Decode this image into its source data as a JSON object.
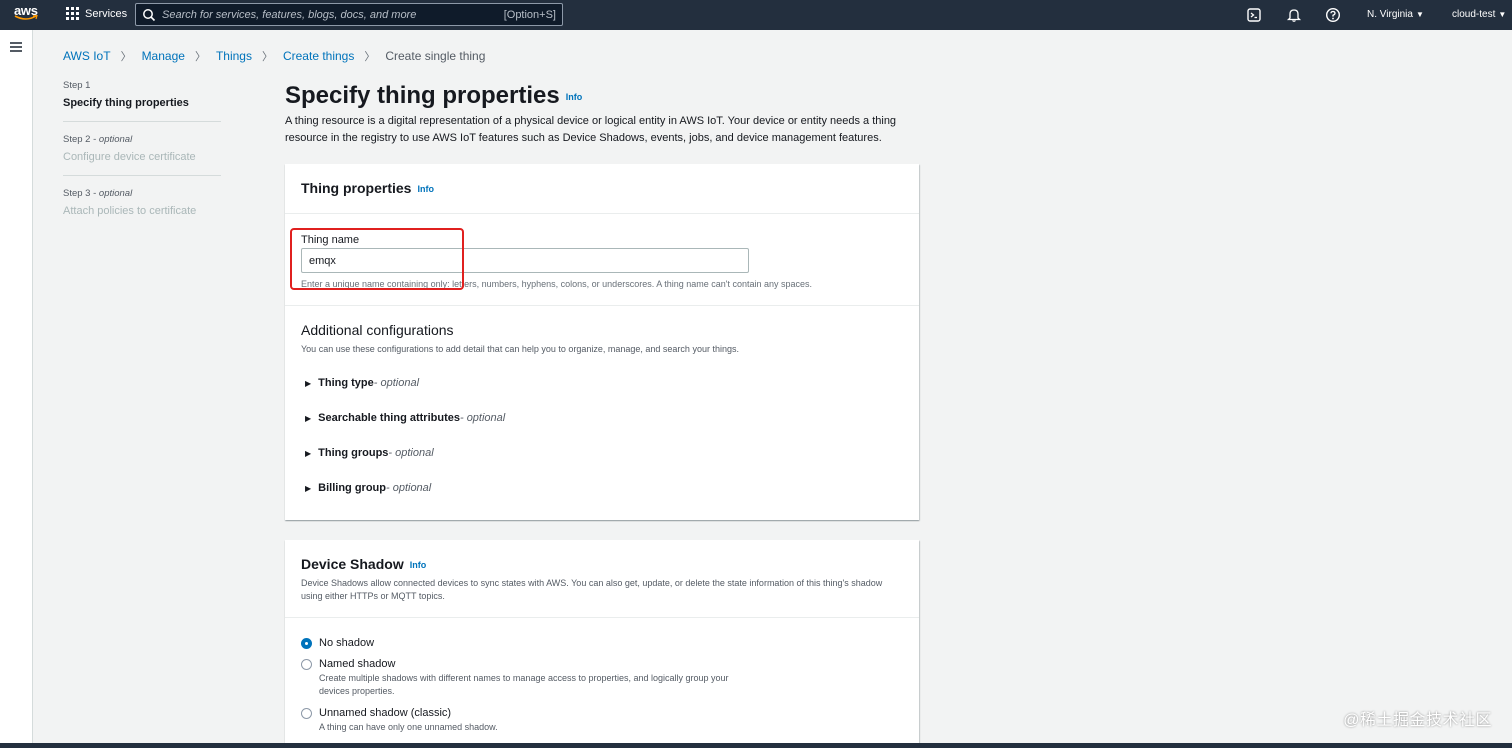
{
  "topnav": {
    "logo_text": "aws",
    "services_label": "Services",
    "search_placeholder": "Search for services, features, blogs, docs, and more",
    "search_shortcut": "[Option+S]",
    "region": "N. Virginia",
    "account": "cloud-test",
    "icons": [
      "cloudshell-icon",
      "bell-icon",
      "help-icon"
    ]
  },
  "breadcrumb": {
    "items": [
      "AWS IoT",
      "Manage",
      "Things",
      "Create things"
    ],
    "current": "Create single thing"
  },
  "steps": [
    {
      "label": "Step 1",
      "optional": "",
      "title": "Specify thing properties",
      "state": "active"
    },
    {
      "label": "Step 2 - ",
      "optional": "optional",
      "title": "Configure device certificate",
      "state": "disabled"
    },
    {
      "label": "Step 3 - ",
      "optional": "optional",
      "title": "Attach policies to certificate",
      "state": "disabled"
    }
  ],
  "page": {
    "title": "Specify thing properties",
    "info": "Info",
    "description": "A thing resource is a digital representation of a physical device or logical entity in AWS IoT. Your device or entity needs a thing resource in the registry to use AWS IoT features such as Device Shadows, events, jobs, and device management features."
  },
  "thing_properties": {
    "title": "Thing properties",
    "info": "Info",
    "name_label": "Thing name",
    "name_value": "emqx",
    "name_hint": "Enter a unique name containing only: letters, numbers, hyphens, colons, or underscores. A thing name can't contain any spaces.",
    "additional_title": "Additional configurations",
    "additional_desc": "You can use these configurations to add detail that can help you to organize, manage, and search your things.",
    "expanders": [
      {
        "label": "Thing type",
        "optional": " - optional"
      },
      {
        "label": "Searchable thing attributes",
        "optional": " - optional"
      },
      {
        "label": "Thing groups",
        "optional": " - optional"
      },
      {
        "label": "Billing group",
        "optional": " - optional"
      }
    ]
  },
  "device_shadow": {
    "title": "Device Shadow",
    "info": "Info",
    "description": "Device Shadows allow connected devices to sync states with AWS. You can also get, update, or delete the state information of this thing's shadow using either HTTPs or MQTT topics.",
    "options": [
      {
        "label": "No shadow",
        "desc": "",
        "checked": true
      },
      {
        "label": "Named shadow",
        "desc": "Create multiple shadows with different names to manage access to properties, and logically group your devices properties.",
        "checked": false
      },
      {
        "label": "Unnamed shadow (classic)",
        "desc": "A thing can have only one unnamed shadow.",
        "checked": false
      }
    ]
  },
  "watermark": "@稀土掘金技术社区",
  "colors": {
    "nav_bg": "#232f3e",
    "link": "#0073bb",
    "highlight": "#e0201f",
    "page_bg": "#f2f3f3"
  }
}
